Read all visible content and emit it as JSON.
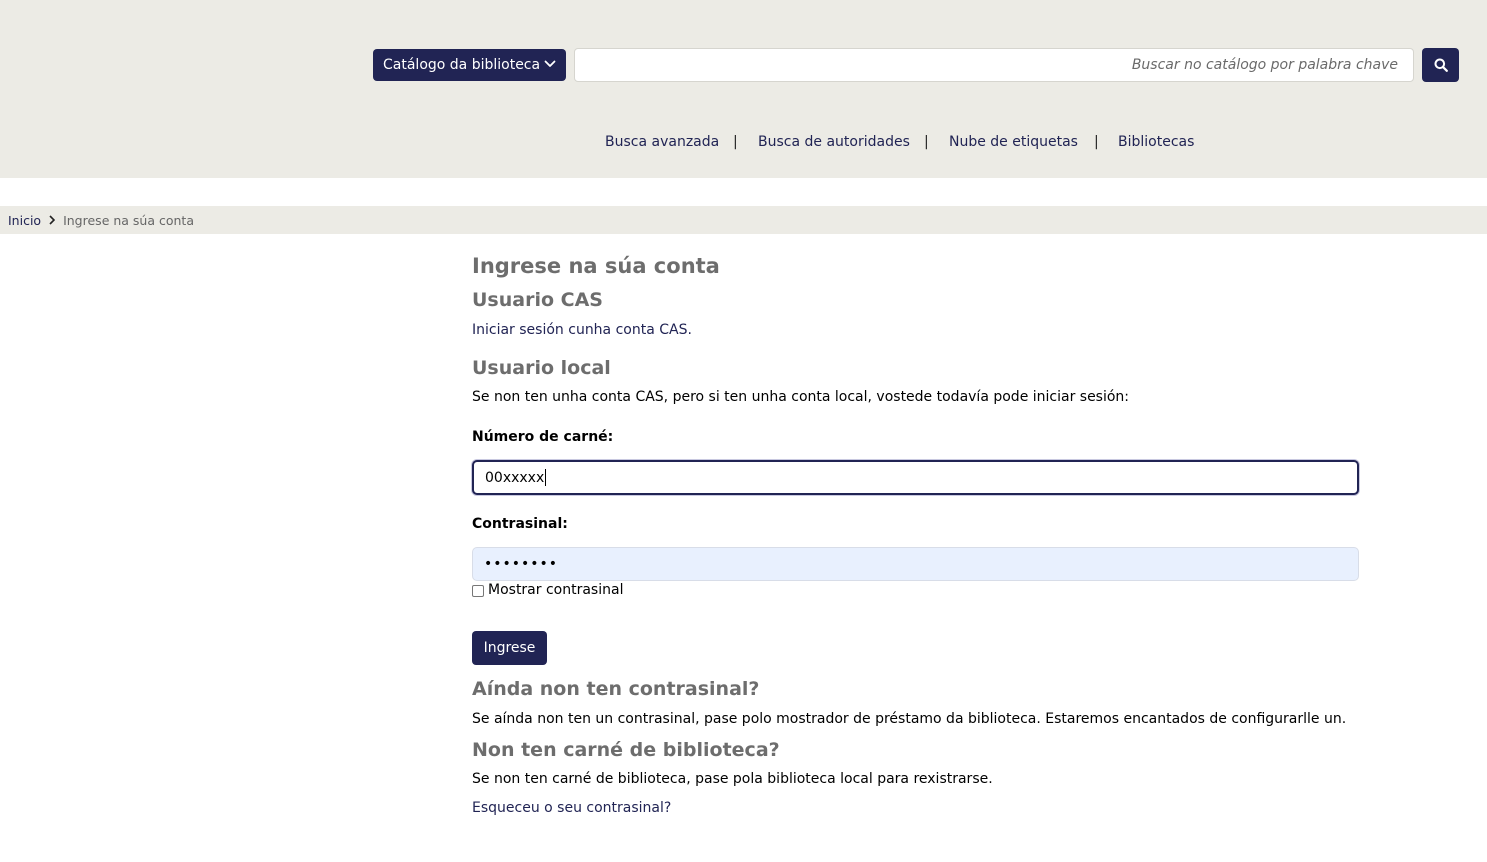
{
  "header": {
    "catalog_label": "Catálogo da biblioteca",
    "search_placeholder": "Buscar no catálogo por palabra chave"
  },
  "nav": {
    "items": [
      "Busca avanzada",
      "Busca de autoridades",
      "Nube de etiquetas",
      "Bibliotecas"
    ],
    "separator": "|"
  },
  "breadcrumb": {
    "home": "Inicio",
    "current": "Ingrese na súa conta"
  },
  "login": {
    "title": "Ingrese na súa conta",
    "cas_heading": "Usuario CAS",
    "cas_link": "Iniciar sesión cunha conta CAS.",
    "local_heading": "Usuario local",
    "local_text": "Se non ten unha conta CAS, pero si ten unha conta local, vostede todavía pode iniciar sesión:",
    "card_label": "Número de carné:",
    "card_value": "00xxxxx",
    "password_label": "Contrasinal:",
    "password_value": "••••••••",
    "show_password": "Mostrar contrasinal",
    "submit_label": "Ingrese",
    "no_password_heading": "Aínda non ten contrasinal?",
    "no_password_text": "Se aínda non ten un contrasinal, pase polo mostrador de préstamo da biblioteca. Estaremos encantados de configurarlle un.",
    "no_card_heading": "Non ten carné de biblioteca?",
    "no_card_text": "Se non ten carné de biblioteca, pase pola biblioteca local para rexistrarse.",
    "forgot_link": "Esqueceu o seu contrasinal?"
  },
  "colors": {
    "accent": "#212454",
    "header_bg": "#ecebe5",
    "heading_gray": "#6d6d6d",
    "autofill_bg": "#e8f0fe"
  },
  "icons": {
    "catalog_dropdown": "chevron-down-icon",
    "search_button": "search-icon",
    "breadcrumb_separator": "chevron-right-icon"
  }
}
